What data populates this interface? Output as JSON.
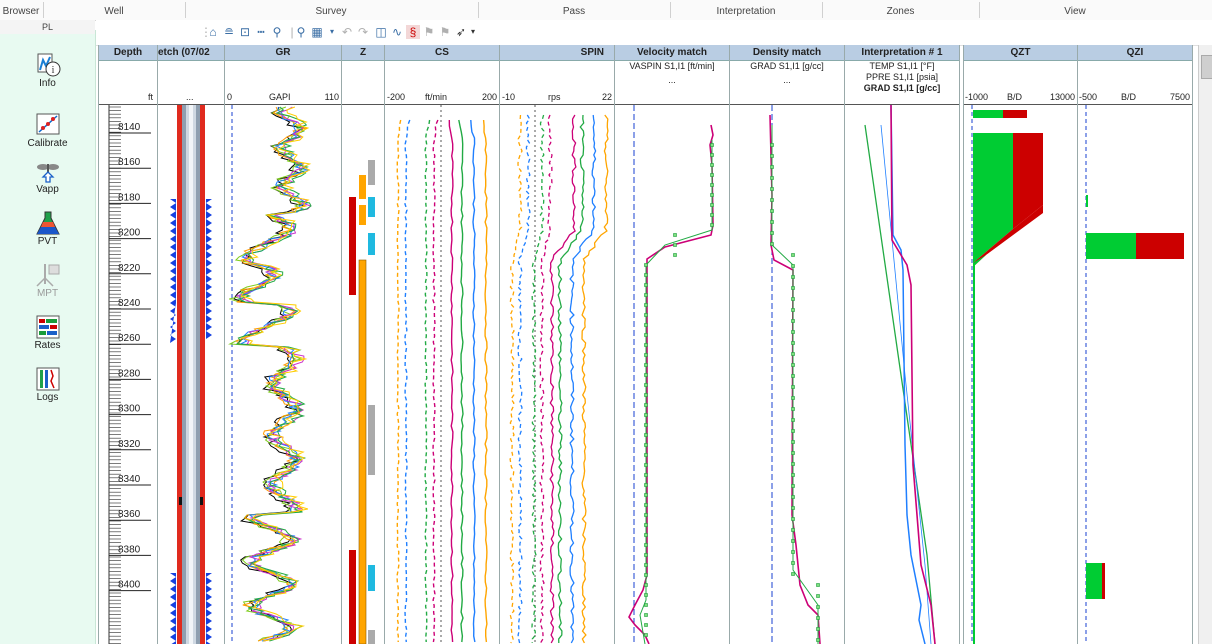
{
  "ribbon": {
    "groups": [
      "Browser",
      "Well",
      "Survey",
      "Pass",
      "Interpretation",
      "Zones",
      "View"
    ]
  },
  "browser": {
    "panel_title": "PL",
    "items": [
      {
        "label": "Info",
        "icon": "info-icon",
        "enabled": true
      },
      {
        "label": "Calibrate",
        "icon": "calibrate-icon",
        "enabled": true
      },
      {
        "label": "Vapp",
        "icon": "vapp-icon",
        "enabled": true
      },
      {
        "label": "PVT",
        "icon": "pvt-flask-icon",
        "enabled": true
      },
      {
        "label": "MPT",
        "icon": "mpt-icon",
        "enabled": false
      },
      {
        "label": "Rates",
        "icon": "rates-icon",
        "enabled": true
      },
      {
        "label": "Logs",
        "icon": "logs-icon",
        "enabled": true
      }
    ]
  },
  "tracks": {
    "depth": {
      "title": "Depth",
      "unit": "ft",
      "labels": [
        "8140",
        "8160",
        "8180",
        "8200",
        "8220",
        "8240",
        "8260",
        "8280",
        "8300",
        "8320",
        "8340",
        "8360",
        "8380",
        "8400"
      ]
    },
    "sketch": {
      "title": "etch (07/02",
      "scale": "..."
    },
    "gr": {
      "title": "GR",
      "min": "0",
      "unit": "GAPI",
      "max": "110"
    },
    "z": {
      "title": "Z"
    },
    "cs": {
      "title": "CS",
      "min": "-200",
      "unit": "ft/min",
      "max": "200"
    },
    "spin": {
      "title": "SPIN",
      "min": "-10",
      "unit": "rps",
      "max": "22"
    },
    "vel": {
      "title": "Velocity match",
      "line1": "VASPIN S1,I1 [ft/min]",
      "line2": "..."
    },
    "dens": {
      "title": "Density match",
      "line1": "GRAD S1,I1 [g/cc]",
      "line2": "..."
    },
    "interp": {
      "title": "Interpretation # 1",
      "line1": "TEMP S1,I1 [°F]",
      "line2": "PPRE S1,I1 [psia]",
      "line3": "GRAD S1,I1 [g/cc]"
    },
    "qzt": {
      "title": "QZT",
      "min": "-1000",
      "unit": "B/D",
      "max": "13000"
    },
    "qzi": {
      "title": "QZI",
      "min": "-500",
      "unit": "B/D",
      "max": "7500"
    }
  },
  "colors": {
    "header": "#b9cde3",
    "water": "#cc0000",
    "oil": "#00cc33",
    "panel": "#e8faf1",
    "tubing": "#e02a1e"
  }
}
